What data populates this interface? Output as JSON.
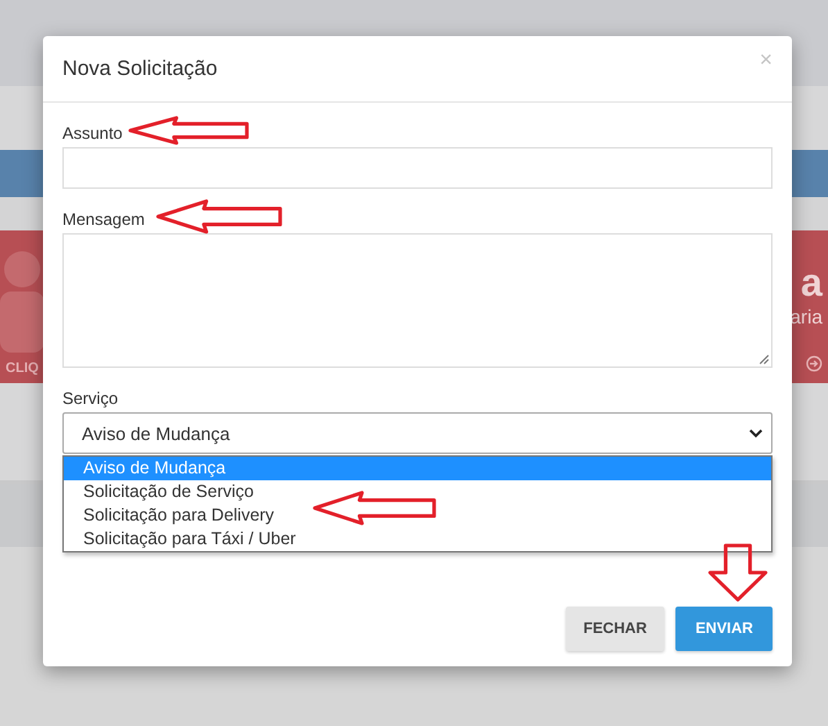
{
  "background": {
    "tile_left_link": "CLIQ",
    "tile_right_big": "a",
    "tile_right_text": "aria"
  },
  "modal": {
    "title": "Nova Solicitação",
    "close": "×",
    "fields": [
      {
        "kind": "input",
        "label": "Assunto"
      },
      {
        "kind": "textarea",
        "label": "Mensagem"
      },
      {
        "kind": "select",
        "label": "Serviço",
        "value": "Aviso de Mudança",
        "expanded": true,
        "options": [
          {
            "label": "Aviso de Mudança",
            "selected": true
          },
          {
            "label": "Solicitação de Serviço",
            "selected": false
          },
          {
            "label": "Solicitação para Delivery",
            "selected": false
          },
          {
            "label": "Solicitação para Táxi / Uber",
            "selected": false
          }
        ]
      }
    ],
    "buttons": [
      {
        "label": "FECHAR",
        "kind": "secondary"
      },
      {
        "label": "ENVIAR",
        "kind": "primary"
      }
    ]
  }
}
